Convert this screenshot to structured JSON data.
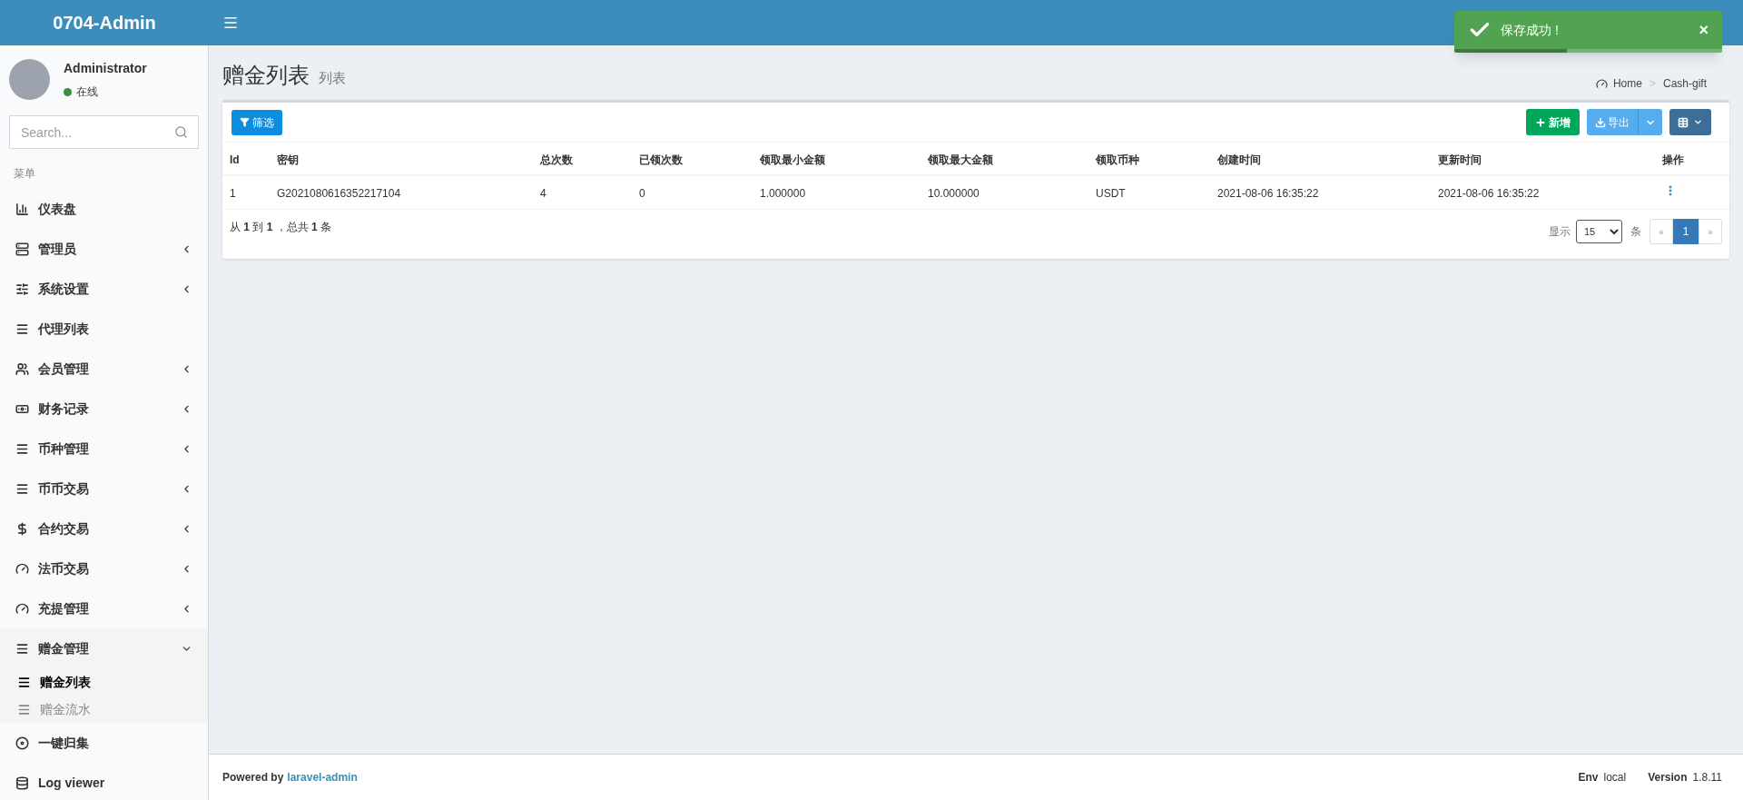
{
  "header": {
    "logo": "0704-Admin"
  },
  "toast": {
    "message": "保存成功 !",
    "close": "×",
    "level": 0.42
  },
  "sidebar": {
    "user": {
      "name": "Administrator",
      "status": "在线"
    },
    "search": {
      "placeholder": "Search..."
    },
    "menu_title": "菜单",
    "items": [
      {
        "label": "仪表盘",
        "kind": "link",
        "selected": false
      },
      {
        "label": "管理员",
        "kind": "group",
        "expanded": false
      },
      {
        "label": "系统设置",
        "kind": "group",
        "expanded": false
      },
      {
        "label": "代理列表",
        "kind": "link",
        "selected": false
      },
      {
        "label": "会员管理",
        "kind": "group",
        "expanded": false
      },
      {
        "label": "财务记录",
        "kind": "group",
        "expanded": false
      },
      {
        "label": "币种管理",
        "kind": "group",
        "expanded": false
      },
      {
        "label": "币币交易",
        "kind": "group",
        "expanded": false
      },
      {
        "label": "合约交易",
        "kind": "group",
        "expanded": false
      },
      {
        "label": "法币交易",
        "kind": "group",
        "expanded": false
      },
      {
        "label": "充提管理",
        "kind": "group",
        "expanded": false
      },
      {
        "label": "赠金管理",
        "kind": "group",
        "expanded": true,
        "children": [
          {
            "label": "赠金列表",
            "selected": true
          },
          {
            "label": "赠金流水",
            "selected": false
          }
        ]
      },
      {
        "label": "一键归集",
        "kind": "link",
        "selected": false
      },
      {
        "label": "Log viewer",
        "kind": "link",
        "selected": false
      }
    ]
  },
  "page": {
    "title": "赠金列表",
    "subtitle": "列表",
    "breadcrumb": [
      "Home",
      "Cash-gift"
    ],
    "breadcrumb_separator": ">"
  },
  "toolbar": {
    "filter": "筛选",
    "create": "新增",
    "export": "导出"
  },
  "table": {
    "columns": [
      "Id",
      "密钥",
      "总次数",
      "已领次数",
      "领取最小金额",
      "领取最大金额",
      "领取币种",
      "创建时间",
      "更新时间",
      "操作"
    ],
    "rows": [
      [
        "1",
        "G2021080616352217104",
        "4",
        "0",
        "1.000000",
        "10.000000",
        "USDT",
        "2021-08-06 16:35:22",
        "2021-08-06 16:35:22"
      ]
    ]
  },
  "summary": "从 **1** 到 **1** ，总共 **1** 条",
  "pagination": {
    "show_label": "显示",
    "per_page": "15",
    "unit": "条",
    "prev": "«",
    "next": "»",
    "pages": [
      {
        "label": "1",
        "selected": true
      }
    ]
  },
  "footer": {
    "powered_by": "Powered by",
    "link": "laravel-admin",
    "env_label": "Env",
    "env": "local",
    "version_label": "Version",
    "version": "1.8.11"
  }
}
